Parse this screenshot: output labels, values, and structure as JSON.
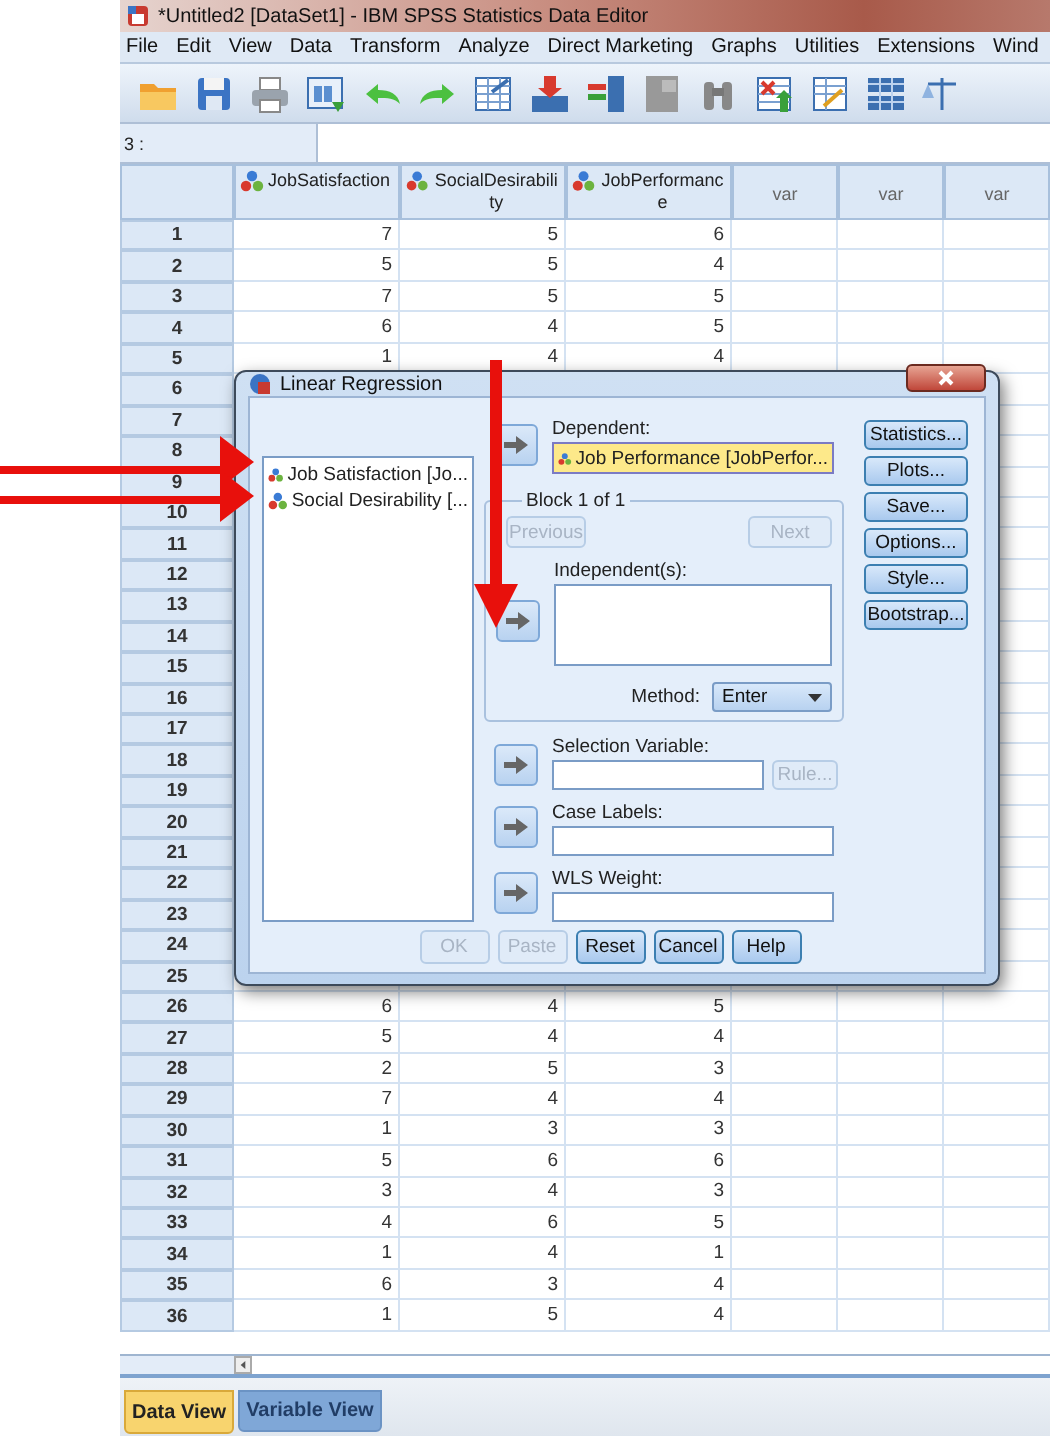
{
  "window": {
    "title": "*Untitled2 [DataSet1] - IBM SPSS Statistics Data Editor"
  },
  "menu": [
    "File",
    "Edit",
    "View",
    "Data",
    "Transform",
    "Analyze",
    "Direct Marketing",
    "Graphs",
    "Utilities",
    "Extensions",
    "Wind"
  ],
  "cell_reference": "3 :",
  "grid": {
    "columns": [
      {
        "label": "JobSatisfaction",
        "kind": "variable"
      },
      {
        "label": "SocialDesirability",
        "kind": "variable"
      },
      {
        "label": "JobPerformance",
        "kind": "variable"
      },
      {
        "label": "var",
        "kind": "empty"
      },
      {
        "label": "var",
        "kind": "empty"
      },
      {
        "label": "var",
        "kind": "empty"
      }
    ],
    "rows": [
      {
        "number": "1",
        "values": [
          "7",
          "5",
          "6"
        ]
      },
      {
        "number": "2",
        "values": [
          "5",
          "5",
          "4"
        ]
      },
      {
        "number": "3",
        "values": [
          "7",
          "5",
          "5"
        ]
      },
      {
        "number": "4",
        "values": [
          "6",
          "4",
          "5"
        ]
      },
      {
        "number": "5",
        "values": [
          "1",
          "4",
          "4"
        ]
      },
      {
        "number": "6"
      },
      {
        "number": "7"
      },
      {
        "number": "8"
      },
      {
        "number": "9"
      },
      {
        "number": "10"
      },
      {
        "number": "11"
      },
      {
        "number": "12"
      },
      {
        "number": "13"
      },
      {
        "number": "14"
      },
      {
        "number": "15"
      },
      {
        "number": "16"
      },
      {
        "number": "17"
      },
      {
        "number": "18"
      },
      {
        "number": "19"
      },
      {
        "number": "20"
      },
      {
        "number": "21"
      },
      {
        "number": "22"
      },
      {
        "number": "23"
      },
      {
        "number": "24"
      },
      {
        "number": "25"
      },
      {
        "number": "26",
        "values": [
          "6",
          "4",
          "5"
        ]
      },
      {
        "number": "27",
        "values": [
          "5",
          "4",
          "4"
        ]
      },
      {
        "number": "28",
        "values": [
          "2",
          "5",
          "3"
        ]
      },
      {
        "number": "29",
        "values": [
          "7",
          "4",
          "4"
        ]
      },
      {
        "number": "30",
        "values": [
          "1",
          "3",
          "3"
        ]
      },
      {
        "number": "31",
        "values": [
          "5",
          "6",
          "6"
        ]
      },
      {
        "number": "32",
        "values": [
          "3",
          "4",
          "3"
        ]
      },
      {
        "number": "33",
        "values": [
          "4",
          "6",
          "5"
        ]
      },
      {
        "number": "34",
        "values": [
          "1",
          "4",
          "1"
        ]
      },
      {
        "number": "35",
        "values": [
          "6",
          "3",
          "4"
        ]
      },
      {
        "number": "36",
        "values": [
          "1",
          "5",
          "4"
        ]
      }
    ]
  },
  "tabs": [
    {
      "label": "Data View",
      "selected": true
    },
    {
      "label": "Variable View",
      "selected": false
    }
  ],
  "dialog": {
    "title": "Linear Regression",
    "variables": [
      {
        "label": "Job Satisfaction [Jo..."
      },
      {
        "label": "Social Desirability [..."
      }
    ],
    "dependent": {
      "label": "Dependent:",
      "value": "Job Performance [JobPerfor...",
      "focused": true
    },
    "block": {
      "label": "Block 1 of 1",
      "previous": {
        "label": "Previous",
        "disabled": true
      },
      "next": {
        "label": "Next",
        "disabled": true
      }
    },
    "independent": {
      "label": "Independent(s):"
    },
    "method": {
      "label": "Method:",
      "value": "Enter"
    },
    "selection": {
      "label": "Selection Variable:",
      "rule": {
        "label": "Rule...",
        "disabled": true
      }
    },
    "case_labels": {
      "label": "Case Labels:"
    },
    "wls": {
      "label": "WLS Weight:"
    },
    "side_buttons": [
      "Statistics...",
      "Plots...",
      "Save...",
      "Options...",
      "Style...",
      "Bootstrap..."
    ],
    "buttons": [
      {
        "label": "OK",
        "disabled": true
      },
      {
        "label": "Paste",
        "disabled": true
      },
      {
        "label": "Reset",
        "disabled": false
      },
      {
        "label": "Cancel",
        "disabled": false
      },
      {
        "label": "Help",
        "disabled": false
      }
    ]
  }
}
